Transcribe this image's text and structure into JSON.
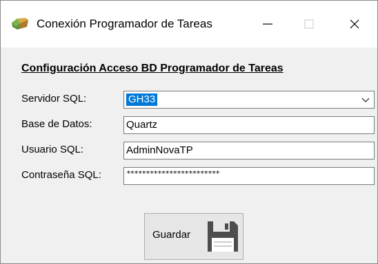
{
  "window": {
    "title": "Conexión Programador de Tareas",
    "controls": {
      "minimize_icon": "minimize-icon",
      "maximize_icon": "maximize-icon",
      "close_icon": "close-icon"
    }
  },
  "form": {
    "section_title": "Configuración Acceso BD Programador de Tareas",
    "fields": {
      "server": {
        "label": "Servidor SQL:",
        "value": "GH33"
      },
      "database": {
        "label": "Base de Datos:",
        "value": "Quartz"
      },
      "user": {
        "label": "Usuario SQL:",
        "value": "AdminNovaTP"
      },
      "password": {
        "label": "Contraseña SQL:",
        "value": "************************"
      }
    },
    "save_button": {
      "label": "Guardar",
      "icon": "floppy-disk-icon"
    }
  },
  "colors": {
    "selection": "#0078d7",
    "window_bg": "#f0f0f0",
    "titlebar_bg": "#ffffff"
  }
}
